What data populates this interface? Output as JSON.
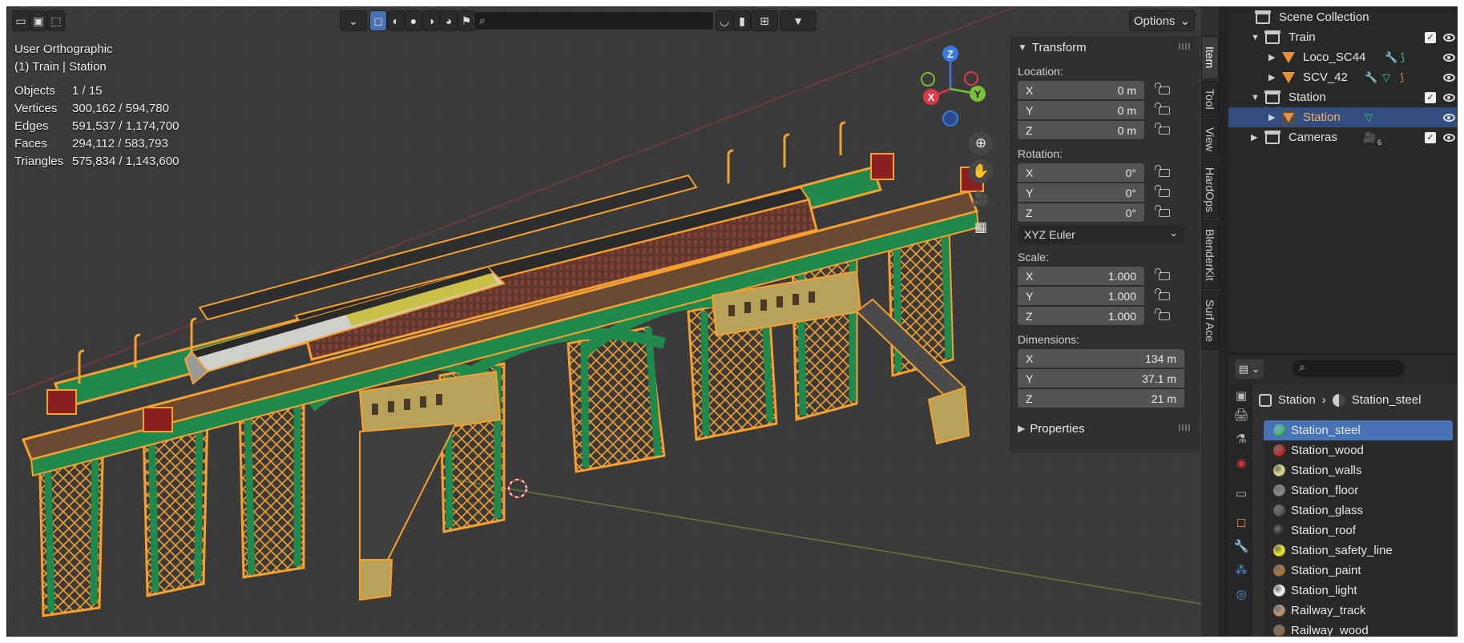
{
  "viewport": {
    "view_name": "User Orthographic",
    "active_label": "(1) Train | Station",
    "stats": [
      {
        "label": "Objects",
        "value": "1 / 15"
      },
      {
        "label": "Vertices",
        "value": "300,162 / 594,780"
      },
      {
        "label": "Edges",
        "value": "591,537 / 1,174,700"
      },
      {
        "label": "Faces",
        "value": "294,112 / 583,793"
      },
      {
        "label": "Triangles",
        "value": "575,834 / 1,143,600"
      }
    ],
    "options_label": "Options",
    "gizmo": {
      "x": "X",
      "y": "Y",
      "z": "Z"
    }
  },
  "npanel": {
    "transform_title": "Transform",
    "location_label": "Location:",
    "location": [
      {
        "axis": "X",
        "value": "0 m"
      },
      {
        "axis": "Y",
        "value": "0 m"
      },
      {
        "axis": "Z",
        "value": "0 m"
      }
    ],
    "rotation_label": "Rotation:",
    "rotation": [
      {
        "axis": "X",
        "value": "0°"
      },
      {
        "axis": "Y",
        "value": "0°"
      },
      {
        "axis": "Z",
        "value": "0°"
      }
    ],
    "rotation_mode": "XYZ Euler",
    "scale_label": "Scale:",
    "scale": [
      {
        "axis": "X",
        "value": "1.000"
      },
      {
        "axis": "Y",
        "value": "1.000"
      },
      {
        "axis": "Z",
        "value": "1.000"
      }
    ],
    "dimensions_label": "Dimensions:",
    "dimensions": [
      {
        "axis": "X",
        "value": "134 m"
      },
      {
        "axis": "Y",
        "value": "37.1 m"
      },
      {
        "axis": "Z",
        "value": "21 m"
      }
    ],
    "properties_title": "Properties",
    "tabs": [
      "Item",
      "Tool",
      "View",
      "HardOps",
      "BlenderKit",
      "Surf Ace"
    ]
  },
  "outliner": {
    "root": "Scene Collection",
    "train": "Train",
    "loco": "Loco_SC44",
    "scv": "SCV_42",
    "station_coll": "Station",
    "station_obj": "Station",
    "cameras": "Cameras",
    "cameras_count": "6"
  },
  "properties": {
    "breadcrumb_object": "Station",
    "breadcrumb_material": "Station_steel",
    "materials": [
      {
        "name": "Station_steel",
        "color": "#3fbf6a"
      },
      {
        "name": "Station_wood",
        "color": "#c0302a"
      },
      {
        "name": "Station_walls",
        "color": "#e6e08a"
      },
      {
        "name": "Station_floor",
        "color": "#8a8a8a"
      },
      {
        "name": "Station_glass",
        "color": "#5a5a5a"
      },
      {
        "name": "Station_roof",
        "color": "#2e2e2e"
      },
      {
        "name": "Station_safety_line",
        "color": "#f2f21a"
      },
      {
        "name": "Station_paint",
        "color": "#b5773a"
      },
      {
        "name": "Station_light",
        "color": "#ffffff"
      },
      {
        "name": "Railway_track",
        "color": "#c09a7a"
      },
      {
        "name": "Railway_wood",
        "color": "#8a6a4a"
      }
    ]
  },
  "colors": {
    "accent": "#4772b3",
    "selection_outline": "#f5a030",
    "steel_green": "#1f8a4c"
  }
}
